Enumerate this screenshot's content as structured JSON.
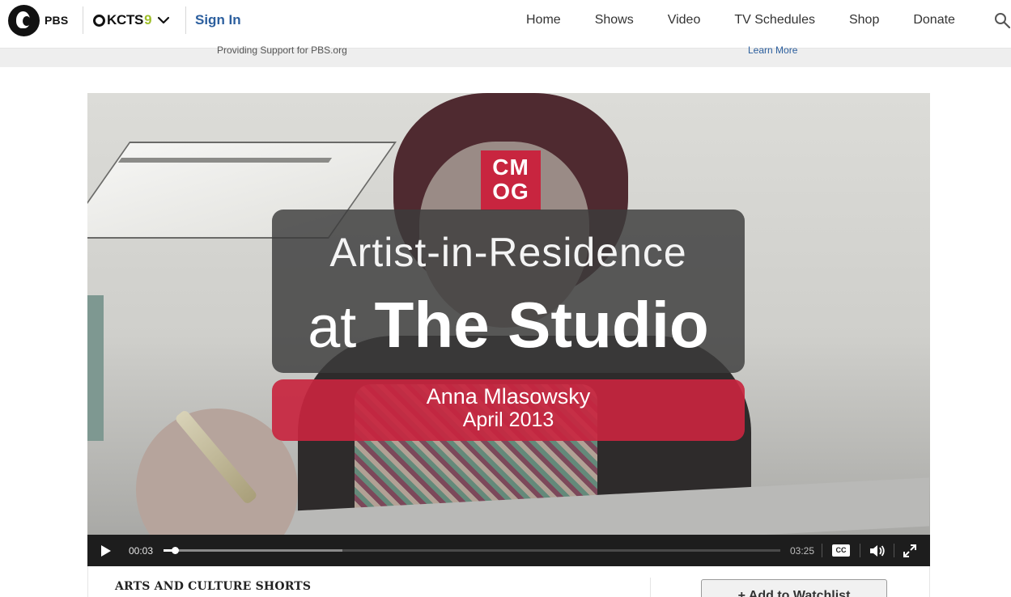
{
  "header": {
    "pbs_label": "PBS",
    "station_name": "KCTS",
    "station_number": "9",
    "signin_label": "Sign In",
    "nav": [
      {
        "label": "Home"
      },
      {
        "label": "Shows"
      },
      {
        "label": "Video"
      },
      {
        "label": "TV Schedules"
      },
      {
        "label": "Shop"
      },
      {
        "label": "Donate"
      }
    ],
    "search_icon": "search-icon"
  },
  "sponsor": {
    "text": "Providing Support for PBS.org",
    "link": "Learn More"
  },
  "video": {
    "logo_text_top": "CM",
    "logo_text_bottom": "OG",
    "title_line1": "Artist-in-Residence",
    "title_line2_at": "at",
    "title_line2_rest": "The Studio",
    "name_line1": "Anna Mlasowsky",
    "name_line2": "April 2013",
    "controls": {
      "current_time": "00:03",
      "total_time": "03:25",
      "cc_label": "CC",
      "played_fraction": 0.018,
      "buffered_fraction": 0.29
    }
  },
  "details": {
    "category": "ARTS AND CULTURE SHORTS",
    "watchlist_label": "+ Add to Watchlist"
  },
  "colors": {
    "brand_blue": "#2c5f9e",
    "station_green": "#9fbf2b",
    "cmog_red": "#c8253f"
  }
}
